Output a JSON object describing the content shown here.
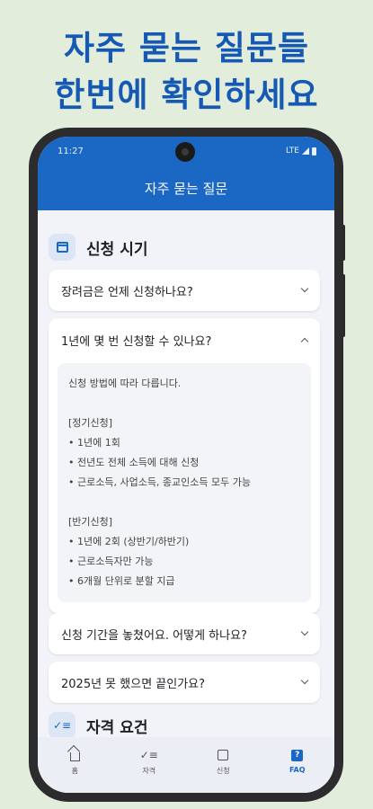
{
  "headline": {
    "line1": "자주 묻는 질문들",
    "line2": "한번에 확인하세요"
  },
  "status": {
    "time": "11:27",
    "network": "LTE"
  },
  "appbar": {
    "title": "자주 묻는 질문"
  },
  "section1": {
    "title": "신청 시기",
    "icon": "calendar-icon"
  },
  "faq": [
    {
      "question": "장려금은 언제 신청하나요?",
      "expanded": false
    },
    {
      "question": "1년에 몇 번 신청할 수 있나요?",
      "expanded": true,
      "answer": [
        "신청 방법에 따라 다릅니다.",
        "",
        "[정기신청]",
        "• 1년에 1회",
        "• 전년도 전체 소득에 대해 신청",
        "• 근로소득, 사업소득, 종교인소득 모두 가능",
        "",
        "[반기신청]",
        "• 1년에 2회 (상반기/하반기)",
        "• 근로소득자만 가능",
        "• 6개월 단위로 분할 지급"
      ]
    },
    {
      "question": "신청 기간을 놓쳤어요. 어떻게 하나요?",
      "expanded": false
    },
    {
      "question": "2025년 못 했으면 끝인가요?",
      "expanded": false
    }
  ],
  "section2": {
    "title": "자격 요건",
    "icon": "checklist-icon"
  },
  "bottom_nav": [
    {
      "label": "홈",
      "icon": "home-icon",
      "active": false
    },
    {
      "label": "자격",
      "icon": "checklist-icon",
      "active": false
    },
    {
      "label": "신청",
      "icon": "calendar-icon",
      "active": false
    },
    {
      "label": "FAQ",
      "icon": "faq-icon",
      "active": true
    }
  ],
  "colors": {
    "primary": "#1b67c4",
    "background": "#e2eedb",
    "headline": "#1559b5"
  }
}
